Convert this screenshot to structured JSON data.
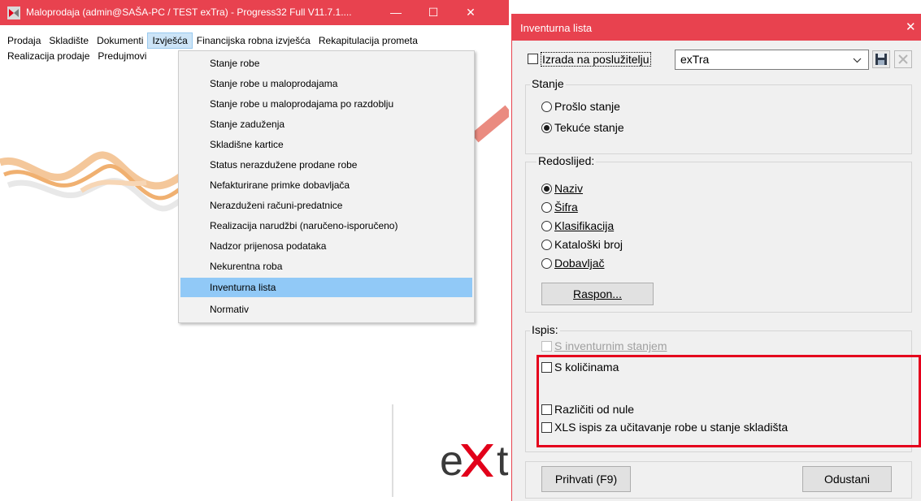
{
  "main_window": {
    "title": "Maloprodaja (admin@SAŠA-PC / TEST exTra) - Progress32 Full V11.7.1....",
    "caption_buttons": {
      "minimize": "—",
      "maximize": "☐",
      "close": "✕"
    },
    "menubar_row1": [
      "Prodaja",
      "Skladište",
      "Dokumenti",
      "Izvješća",
      "Financijska robna izvješća",
      "Rekapitulacija prometa"
    ],
    "menubar_row2": [
      "Realizacija prodaje",
      "Predujmovi"
    ],
    "active_menu": "Izvješća",
    "dropdown_items": [
      "Stanje robe",
      "Stanje robe u maloprodajama",
      "Stanje robe u maloprodajama po razdoblju",
      "Stanje zaduženja",
      "Skladišne kartice",
      "Status nerazdužene prodane robe",
      "Nefakturirane primke dobavljača",
      "Nerazduženi računi-predatnice",
      "Realizacija narudžbi (naručeno-isporučeno)",
      "Nadzor prijenosa podataka",
      "Nekurentna roba",
      "Inventurna lista",
      "Normativ"
    ],
    "highlighted_item": "Inventurna lista",
    "logo_text": "ext"
  },
  "dialog": {
    "title": "Inventurna lista",
    "close": "✕",
    "server_checkbox_label": "Izrada na poslužitelju",
    "server_checked": false,
    "server_value": "exTra",
    "stanje": {
      "label": "Stanje",
      "options": [
        "Prošlo stanje",
        "Tekuće stanje"
      ],
      "selected": "Tekuće stanje"
    },
    "redoslijed": {
      "label": "Redoslijed:",
      "options": [
        "Naziv",
        "Šifra",
        "Klasifikacija",
        "Kataloški broj",
        "Dobavljač"
      ],
      "selected": "Naziv",
      "raspon_button": "Raspon..."
    },
    "ispis": {
      "label": "Ispis:",
      "s_inventurnim": "S inventurnim stanjem",
      "s_kolicinama": "S količinama",
      "razliciti": "Različiti od nule",
      "xls": "XLS ispis za učitavanje robe u stanje skladišta"
    },
    "accept_button": "Prihvati (F9)",
    "cancel_button": "Odustani"
  },
  "colors": {
    "titlebar": "#e8424f",
    "menu_highlight": "#91c9f7",
    "annotation": "#e5001c"
  }
}
